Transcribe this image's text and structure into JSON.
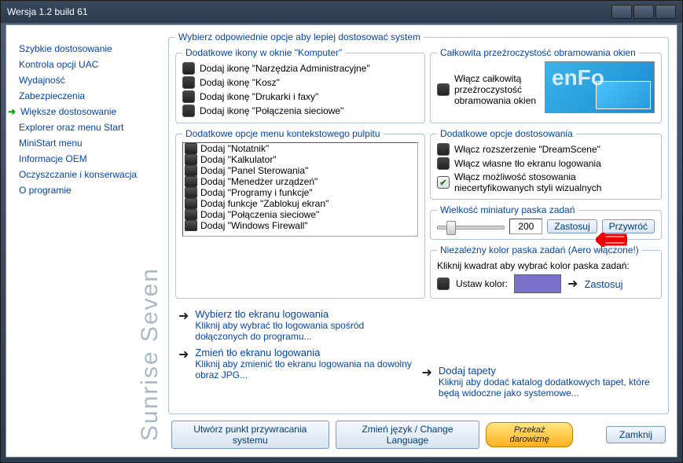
{
  "window": {
    "title": "Wersja 1.2 build 61"
  },
  "sidebar": {
    "brand": "Sunrise Seven",
    "items": [
      "Szybkie dostosowanie",
      "Kontrola opcji UAC",
      "Wydajność",
      "Zabezpieczenia",
      "Większe dostosowanie",
      "Explorer oraz menu Start",
      "MiniStart menu",
      "Informacje OEM",
      "Oczyszczanie i konserwacja",
      "O programie"
    ],
    "active_index": 4
  },
  "main": {
    "heading": "Wybierz odpowiednie opcje aby lepiej dostosować system",
    "group_icons": {
      "legend": "Dodatkowe ikony w oknie \"Komputer\"",
      "items": [
        "Dodaj ikonę \"Narzędzia Administracyjne\"",
        "Dodaj ikonę \"Kosz\"",
        "Dodaj ikonę \"Drukarki i faxy\"",
        "Dodaj ikonę \"Połączenia sieciowe\""
      ]
    },
    "group_border": {
      "legend": "Całkowita przeźroczystość obramowania okien",
      "label": "Włącz całkowitą przeźroczystość obramowania okien"
    },
    "group_context": {
      "legend": "Dodatkowe opcje menu kontekstowego pulpitu",
      "items": [
        "Dodaj \"Notatnik\"",
        "Dodaj \"Kalkulator\"",
        "Dodaj \"Panel Sterowania\"",
        "Dodaj \"Menedżer urządzeń\"",
        "Dodaj \"Programy i funkcje\"",
        "Dodaj funkcje \"Zablokuj ekran\"",
        "Dodaj \"Połączenia sieciowe\"",
        "Dodaj \"Windows Firewall\""
      ]
    },
    "group_extra": {
      "legend": "Dodatkowe opcje dostosowania",
      "items": [
        {
          "label": "Włącz rozszerzenie \"DreamScene\"",
          "checked": false
        },
        {
          "label": "Włącz własne tło ekranu logowania",
          "checked": false
        },
        {
          "label": "Włącz możliwość stosowania niecertyfikowanych styli wizualnych",
          "checked": true
        }
      ]
    },
    "group_thumb": {
      "legend": "Wielkość miniatury paska zadań",
      "value": "200",
      "apply": "Zastosuj",
      "restore": "Przywróć"
    },
    "group_color": {
      "legend": "Niezależny kolor paska zadań (Aero włączone!)",
      "note": "Kliknij kwadrat aby wybrać kolor paska zadań:",
      "set_label": "Ustaw kolor:",
      "apply": "Zastosuj",
      "color": "#7a72c8"
    },
    "links": {
      "l1_head": "Wybierz tło ekranu logowania",
      "l1_desc": "Kliknij aby wybrać tło logowania spośród dołączonych do programu...",
      "l2_head": "Zmień tło ekranu logowania",
      "l2_desc": "Kliknij aby zmienić tło ekranu logowania na dowolny obraz JPG...",
      "l3_head": "Dodaj tapety",
      "l3_desc": "Kliknij aby dodać katalog dodatkowych tapet, które będą widoczne jako systemowe..."
    }
  },
  "bottom": {
    "restore": "Utwórz punkt przywracania systemu",
    "lang": "Zmień język / Change Language",
    "donate": "Przekaż darowiznę",
    "close": "Zamknij"
  }
}
